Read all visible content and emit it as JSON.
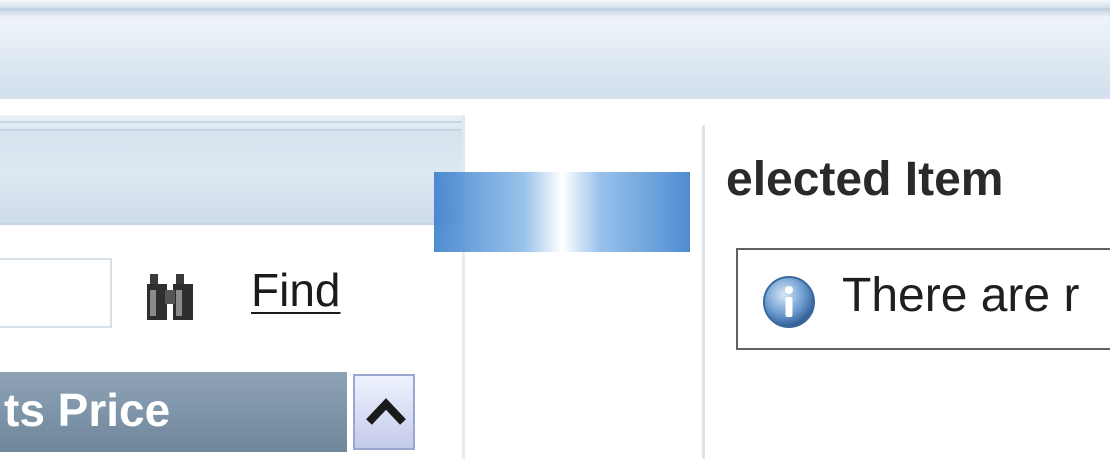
{
  "search": {
    "value": "",
    "find_label": "Find",
    "icon": "binoculars-icon"
  },
  "results_grid": {
    "column_header": "ts Price",
    "sort_icon": "sort-ascending-icon"
  },
  "selected_panel": {
    "title": "elected Item",
    "message": "There are r",
    "message_icon": "info-icon"
  },
  "colors": {
    "header_blue": "#7a90a5",
    "accent_blue": "#3c7fcc",
    "panel_border": "#5f6266"
  }
}
